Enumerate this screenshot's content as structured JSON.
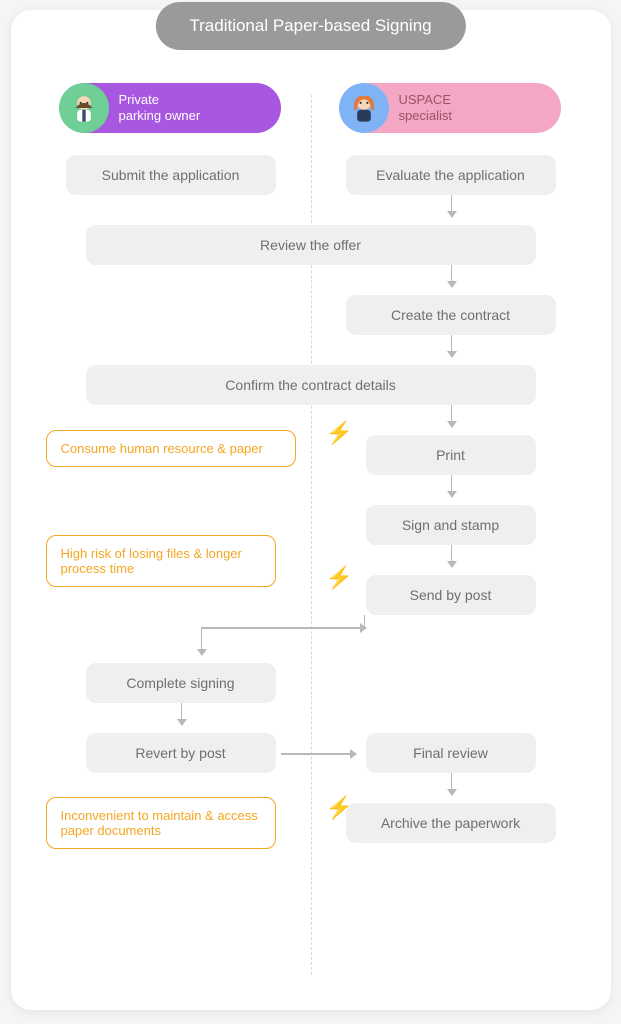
{
  "title": "Traditional Paper-based Signing",
  "roles": {
    "left": "Private\nparking owner",
    "right": "USPACE\nspecialist"
  },
  "steps": {
    "submit": "Submit the application",
    "evaluate": "Evaluate the application",
    "review_offer": "Review the offer",
    "create_contract": "Create the contract",
    "confirm": "Confirm the contract details",
    "print": "Print",
    "sign_stamp": "Sign and stamp",
    "send_post": "Send by post",
    "complete_signing": "Complete signing",
    "revert_post": "Revert by post",
    "final_review": "Final review",
    "archive": "Archive the paperwork"
  },
  "callouts": {
    "c1": "Consume human resource & paper",
    "c2": "High risk of losing files & longer process time",
    "c3": "Inconvenient to maintain & access paper documents"
  },
  "icons": {
    "bolt": "⚡"
  }
}
